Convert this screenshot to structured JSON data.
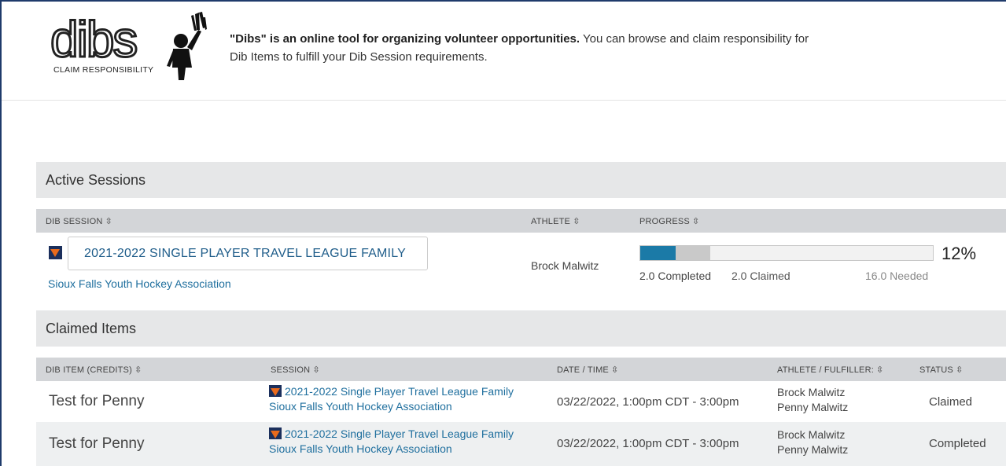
{
  "header": {
    "logo_word": "dibs",
    "logo_tagline": "CLAIM RESPONSIBILITY",
    "intro_bold": "\"Dibs\" is an online tool for organizing volunteer opportunities.",
    "intro_rest": " You can browse and claim responsibility for Dib Items to fulfill your Dib Session requirements."
  },
  "active_sessions": {
    "title": "Active Sessions",
    "columns": [
      "DIB SESSION",
      "ATHLETE",
      "PROGRESS"
    ],
    "sort_icon": "sort-icon",
    "row": {
      "session_name": "2021-2022 SINGLE PLAYER TRAVEL LEAGUE FAMILY",
      "organization": "Sioux Falls Youth Hockey Association",
      "athlete": "Brock Malwitz",
      "progress_percent_label": "12%",
      "progress_completed_fraction": 0.12,
      "progress_claimed_fraction": 0.12,
      "completed_label": "2.0 Completed",
      "claimed_label": "2.0 Claimed",
      "needed_label": "16.0 Needed"
    }
  },
  "claimed_items": {
    "title": "Claimed Items",
    "columns": [
      "DIB ITEM (CREDITS)",
      "SESSION",
      "DATE / TIME",
      "ATHLETE / FULFILLER:",
      "STATUS"
    ],
    "rows": [
      {
        "item": "Test for Penny",
        "session": "2021-2022 Single Player Travel League Family",
        "organization": "Sioux Falls Youth Hockey Association",
        "datetime": "03/22/2022, 1:00pm CDT - 3:00pm",
        "athlete": "Brock Malwitz",
        "fulfiller": "Penny Malwitz",
        "status": "Claimed"
      },
      {
        "item": "Test for Penny",
        "session": "2021-2022 Single Player Travel League Family",
        "organization": "Sioux Falls Youth Hockey Association",
        "datetime": "03/22/2022, 1:00pm CDT - 3:00pm",
        "athlete": "Brock Malwitz",
        "fulfiller": "Penny Malwitz",
        "status": "Completed"
      }
    ]
  },
  "colors": {
    "frame_border": "#1f3b6b",
    "link": "#1f6f9e",
    "progress_completed": "#1b7aa7",
    "progress_claimed": "#c9c9c9",
    "section_bar": "#e6e7e8",
    "column_header": "#d3d5d8",
    "flag_navy": "#1b2f5c",
    "flag_orange": "#e96a1c"
  }
}
